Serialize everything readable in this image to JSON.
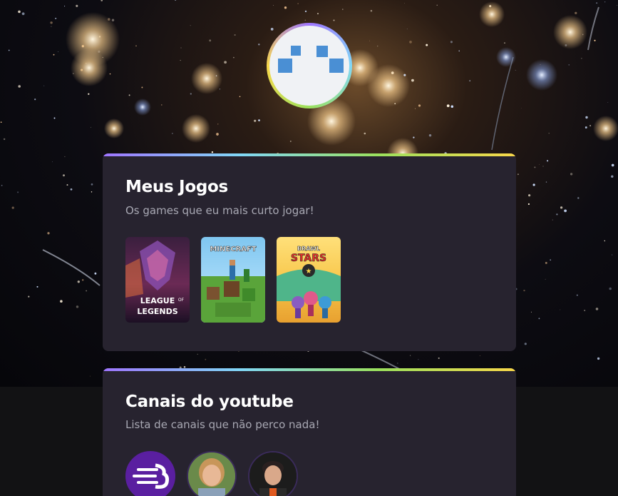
{
  "profile": {
    "avatar_icon": "pixel-eyes-icon"
  },
  "games_section": {
    "title": "Meus Jogos",
    "description": "Os games que eu mais curto jogar!",
    "items": [
      {
        "name": "League of Legends",
        "logo_line1": "LEAGUE",
        "logo_of": "OF",
        "logo_line2": "LEGENDS"
      },
      {
        "name": "Minecraft",
        "logo_text": "MINECRAFT"
      },
      {
        "name": "Brawl Stars",
        "logo_line1": "BRAWL",
        "logo_line2": "STARS"
      }
    ]
  },
  "channels_section": {
    "title": "Canais do youtube",
    "description": "Lista de canais que não perco nada!",
    "items": [
      {
        "name": "rocketseat-channel"
      },
      {
        "name": "channel-2"
      },
      {
        "name": "channel-3"
      }
    ]
  },
  "colors": {
    "accent_gradient": [
      "#9f75ff",
      "#81d8f7",
      "#9be15d",
      "#f9d84a"
    ],
    "card_bg": "#27232f",
    "page_bg": "#121214"
  }
}
